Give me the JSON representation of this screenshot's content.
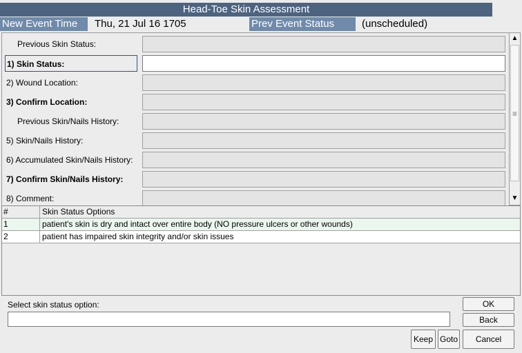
{
  "window": {
    "title": "Head-Toe Skin Assessment"
  },
  "header": {
    "new_event_label": "New Event Time",
    "new_event_value": "Thu, 21 Jul 16  1705",
    "prev_status_label": "Prev Event Status",
    "prev_status_value": "(unscheduled)"
  },
  "form": {
    "fields": [
      {
        "label": "Previous Skin Status:",
        "value": ""
      },
      {
        "label": "1)  Skin Status:",
        "value": ""
      },
      {
        "label": "2)  Wound Location:",
        "value": ""
      },
      {
        "label": "3)  Confirm Location:",
        "value": ""
      },
      {
        "label": "Previous Skin/Nails History:",
        "value": ""
      },
      {
        "label": "5)  Skin/Nails History:",
        "value": ""
      },
      {
        "label": "6)  Accumulated Skin/Nails History:",
        "value": ""
      },
      {
        "label": "7)  Confirm Skin/Nails History:",
        "value": ""
      },
      {
        "label": "8)  Comment:",
        "value": ""
      }
    ]
  },
  "options": {
    "col_num": "#",
    "col_text": "Skin Status Options",
    "rows": [
      {
        "num": "1",
        "text": "patient's skin is dry and intact over entire body (NO pressure ulcers or other wounds)"
      },
      {
        "num": "2",
        "text": "patient has impaired skin integrity and/or skin issues"
      }
    ]
  },
  "bottom": {
    "prompt": "Select skin status option:",
    "input_value": "",
    "ok_label": "OK",
    "back_label": "Back",
    "keep_label": "Keep",
    "goto_label": "Goto",
    "cancel_label": "Cancel"
  },
  "scrollbar": {
    "up_icon": "▲",
    "down_icon": "▼",
    "grip_icon": "≡"
  }
}
